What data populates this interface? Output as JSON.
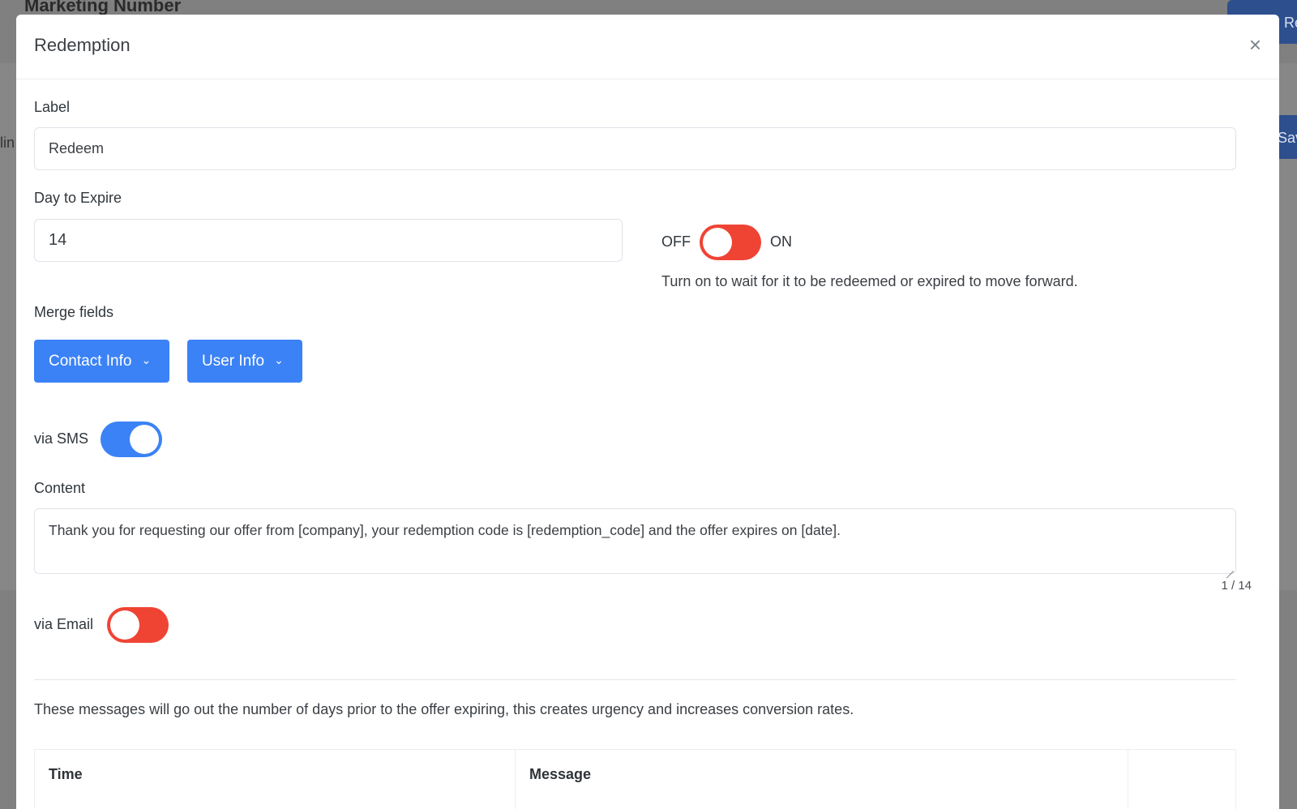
{
  "background": {
    "page_title": "Marketing Number",
    "side_text": "lin",
    "top_button_label": "Re",
    "save_button_label": "Sav"
  },
  "modal": {
    "title": "Redemption",
    "close_label": "×",
    "label_field": {
      "label": "Label",
      "value": "Redeem"
    },
    "expire_field": {
      "label": "Day to Expire",
      "value": "14"
    },
    "wait_toggle": {
      "off_label": "OFF",
      "on_label": "ON",
      "state": "off",
      "color": "#ef4434",
      "hint": "Turn on to wait for it to be redeemed or expired to move forward."
    },
    "merge_fields": {
      "label": "Merge fields",
      "buttons": [
        "Contact Info",
        "User Info"
      ],
      "chevron": "chevron-down-icon"
    },
    "sms_toggle": {
      "label": "via SMS",
      "state": "on",
      "color": "#3b82f6"
    },
    "content": {
      "label": "Content",
      "value": "Thank you for requesting our offer from [company], your redemption code is [redemption_code] and the offer expires on [date].",
      "counter": "1 / 14"
    },
    "email_toggle": {
      "label": "via Email",
      "state": "off",
      "color": "#ef4434"
    },
    "info_text": "These messages will go out the number of days prior to the offer expiring, this creates urgency and increases conversion rates.",
    "table": {
      "columns": [
        "Time",
        "Message",
        ""
      ]
    }
  },
  "colors": {
    "primary": "#3b82f6",
    "danger": "#ef4434",
    "overlay": "#808080"
  }
}
